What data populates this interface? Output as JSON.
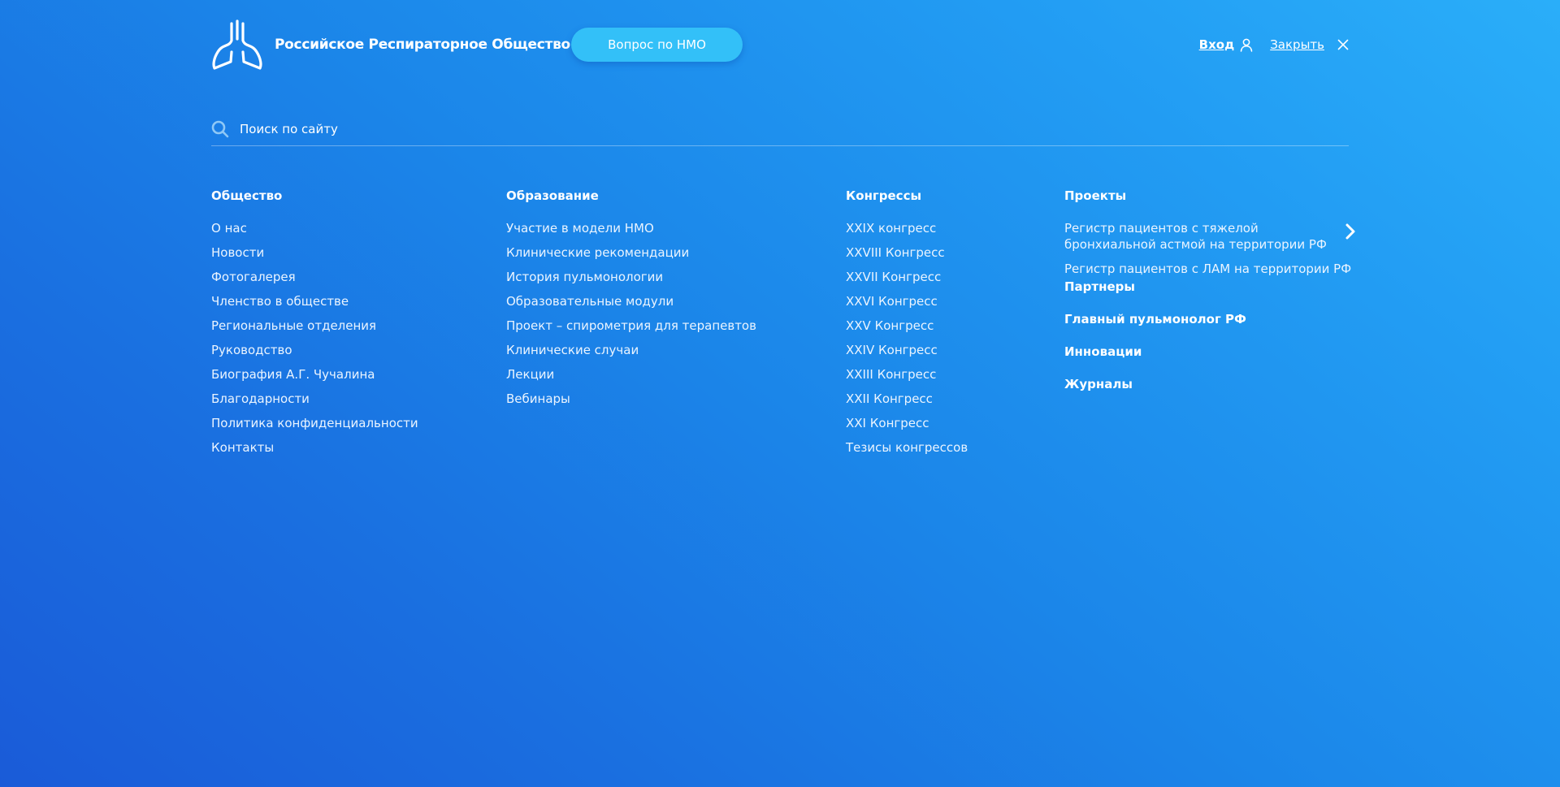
{
  "header": {
    "logo_text": "Российское Респираторное Общество",
    "nmo_button": "Вопрос по НМО",
    "login_label": "Вход",
    "close_label": "Закрыть"
  },
  "search": {
    "placeholder": "Поиск по сайту"
  },
  "menu": {
    "obshchestvo": {
      "heading": "Общество",
      "items": [
        "О нас",
        "Новости",
        "Фотогалерея",
        "Членство в обществе",
        "Региональные отделения",
        "Руководство",
        "Биография А.Г. Чучалина",
        "Благодарности",
        "Политика конфиденциальности",
        "Контакты"
      ]
    },
    "obrazovanie": {
      "heading": "Образование",
      "items": [
        "Участие в модели НМО",
        "Клинические рекомендации",
        "История пульмонологии",
        "Образовательные модули",
        "Проект – спирометрия для терапевтов",
        "Клинические случаи",
        "Лекции",
        "Вебинары"
      ]
    },
    "kongressy": {
      "heading": "Конгрессы",
      "items": [
        "XXIX конгресс",
        "XXVIII Конгресс",
        "XXVII Конгресс",
        "XXVI Конгресс",
        "XXV Конгресс",
        "XXIV Конгресс",
        "XXIII Конгресс",
        "XXII Конгресс",
        "XXI Конгресс",
        "Тезисы конгрессов"
      ]
    },
    "proekty": {
      "heading": "Проекты",
      "items": [
        "Регистр пациентов с тяжелой бронхиальной астмой на территории РФ",
        "Регистр пациентов с ЛАМ на территории РФ"
      ],
      "sub_headings": [
        "Партнеры",
        "Главный пульмонолог РФ",
        "Инновации",
        "Журналы"
      ]
    }
  },
  "icons": {
    "logo": "lungs-icon",
    "user": "user-icon",
    "close": "close-icon",
    "search": "search-icon",
    "chevron": "chevron-right-icon"
  },
  "colors": {
    "bg_top_right": "#2aaef9",
    "bg_bottom_left": "#1a5bd8",
    "button": "#33c0f8"
  }
}
